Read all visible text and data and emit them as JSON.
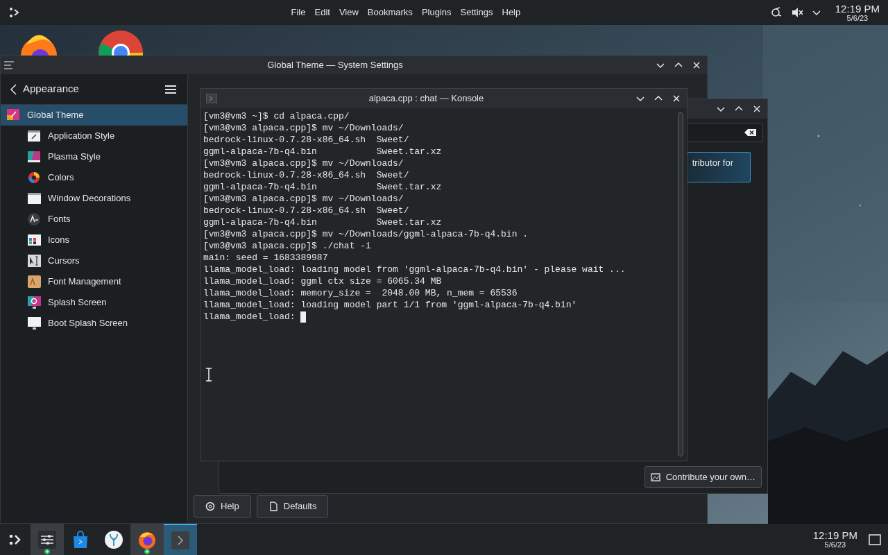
{
  "top_bar": {
    "menu": [
      "File",
      "Edit",
      "View",
      "Bookmarks",
      "Plugins",
      "Settings",
      "Help"
    ],
    "clock": {
      "time": "12:19 PM",
      "date": "5/6/23"
    }
  },
  "settings_window": {
    "title": "Global Theme — System Settings",
    "sidebar": {
      "header": "Appearance",
      "items": [
        {
          "label": "Global Theme",
          "selected": true
        },
        {
          "label": "Application Style",
          "selected": false
        },
        {
          "label": "Plasma Style",
          "selected": false
        },
        {
          "label": "Colors",
          "selected": false
        },
        {
          "label": "Window Decorations",
          "selected": false
        },
        {
          "label": "Fonts",
          "selected": false
        },
        {
          "label": "Icons",
          "selected": false
        },
        {
          "label": "Cursors",
          "selected": false
        },
        {
          "label": "Font Management",
          "selected": false
        },
        {
          "label": "Splash Screen",
          "selected": false
        },
        {
          "label": "Boot Splash Screen",
          "selected": false
        }
      ]
    },
    "buttons": [
      "Help",
      "Defaults"
    ]
  },
  "dialog": {
    "card_text": "tributor for",
    "button": "Contribute your own…"
  },
  "konsole": {
    "title": "alpaca.cpp : chat — Konsole",
    "lines": [
      "[vm3@vm3 ~]$ cd alpaca.cpp/",
      "[vm3@vm3 alpaca.cpp]$ mv ~/Downloads/",
      "bedrock-linux-0.7.28-x86_64.sh  Sweet/",
      "ggml-alpaca-7b-q4.bin           Sweet.tar.xz",
      "[vm3@vm3 alpaca.cpp]$ mv ~/Downloads/",
      "bedrock-linux-0.7.28-x86_64.sh  Sweet/",
      "ggml-alpaca-7b-q4.bin           Sweet.tar.xz",
      "[vm3@vm3 alpaca.cpp]$ mv ~/Downloads/",
      "bedrock-linux-0.7.28-x86_64.sh  Sweet/",
      "ggml-alpaca-7b-q4.bin           Sweet.tar.xz",
      "[vm3@vm3 alpaca.cpp]$ mv ~/Downloads/ggml-alpaca-7b-q4.bin .",
      "[vm3@vm3 alpaca.cpp]$ ./chat -i",
      "main: seed = 1683389987",
      "llama_model_load: loading model from 'ggml-alpaca-7b-q4.bin' - please wait ...",
      "llama_model_load: ggml ctx size = 6065.34 MB",
      "llama_model_load: memory_size =  2048.00 MB, n_mem = 65536",
      "llama_model_load: loading model part 1/1 from 'ggml-alpaca-7b-q4.bin'",
      "llama_model_load: "
    ]
  },
  "taskbar": {
    "tasks": [
      {
        "kind": "settings",
        "open": true,
        "selected": false
      },
      {
        "kind": "store",
        "open": false,
        "selected": false
      },
      {
        "kind": "app",
        "open": false,
        "selected": false
      },
      {
        "kind": "browser",
        "open": true,
        "selected": false
      },
      {
        "kind": "terminal",
        "open": false,
        "selected": true
      }
    ],
    "clock": {
      "time": "12:19 PM",
      "date": "5/6/23"
    }
  }
}
